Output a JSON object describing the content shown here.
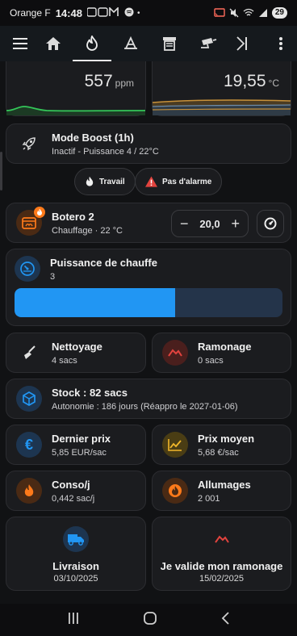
{
  "status_bar": {
    "carrier": "Orange F",
    "time": "14:48",
    "battery": "29"
  },
  "toolbar": {
    "tabs": [
      "menu-icon",
      "home-icon",
      "flame-icon",
      "radiator-icon",
      "hopper-icon",
      "camera-icon",
      "energy-icon"
    ],
    "active_tab": "flame-icon"
  },
  "graphs": {
    "co2": {
      "value": "557",
      "unit": "ppm"
    },
    "temperature": {
      "value": "19,55",
      "unit": "°C"
    }
  },
  "boost": {
    "title": "Mode Boost (1h)",
    "subtitle": "Inactif - Puissance 4 / 22°C"
  },
  "chips": {
    "travail": "Travail",
    "alarme": "Pas d'alarme"
  },
  "stove": {
    "name": "Botero 2",
    "subtitle": "Chauffage · 22 °C",
    "setpoint": "20,0",
    "minus": "−",
    "plus": "+"
  },
  "power": {
    "title": "Puissance de chauffe",
    "value": "3",
    "level_fraction": 0.6
  },
  "nettoyage": {
    "title": "Nettoyage",
    "subtitle": "4 sacs"
  },
  "ramonage": {
    "title": "Ramonage",
    "subtitle": "0 sacs"
  },
  "stock": {
    "title": "Stock : 82 sacs",
    "subtitle": "Autonomie : 186 jours (Réappro le 2027-01-06)"
  },
  "dernier_prix": {
    "title": "Dernier prix",
    "subtitle": "5,85 EUR/sac"
  },
  "prix_moyen": {
    "title": "Prix moyen",
    "subtitle": "5,68 €/sac"
  },
  "conso": {
    "title": "Conso/j",
    "subtitle": "0,442 sac/j"
  },
  "allumages": {
    "title": "Allumages",
    "subtitle": "2 001"
  },
  "livraison": {
    "title": "Livraison",
    "subtitle": "03/10/2025"
  },
  "valide_ramonage": {
    "title": "Je valide mon ramonage",
    "subtitle": "15/02/2025"
  },
  "colors": {
    "accent_blue": "#2196f3",
    "orange": "#ff7a1a",
    "red": "#e2433e",
    "yellow": "#f1b72b",
    "green_line": "#34c759"
  }
}
